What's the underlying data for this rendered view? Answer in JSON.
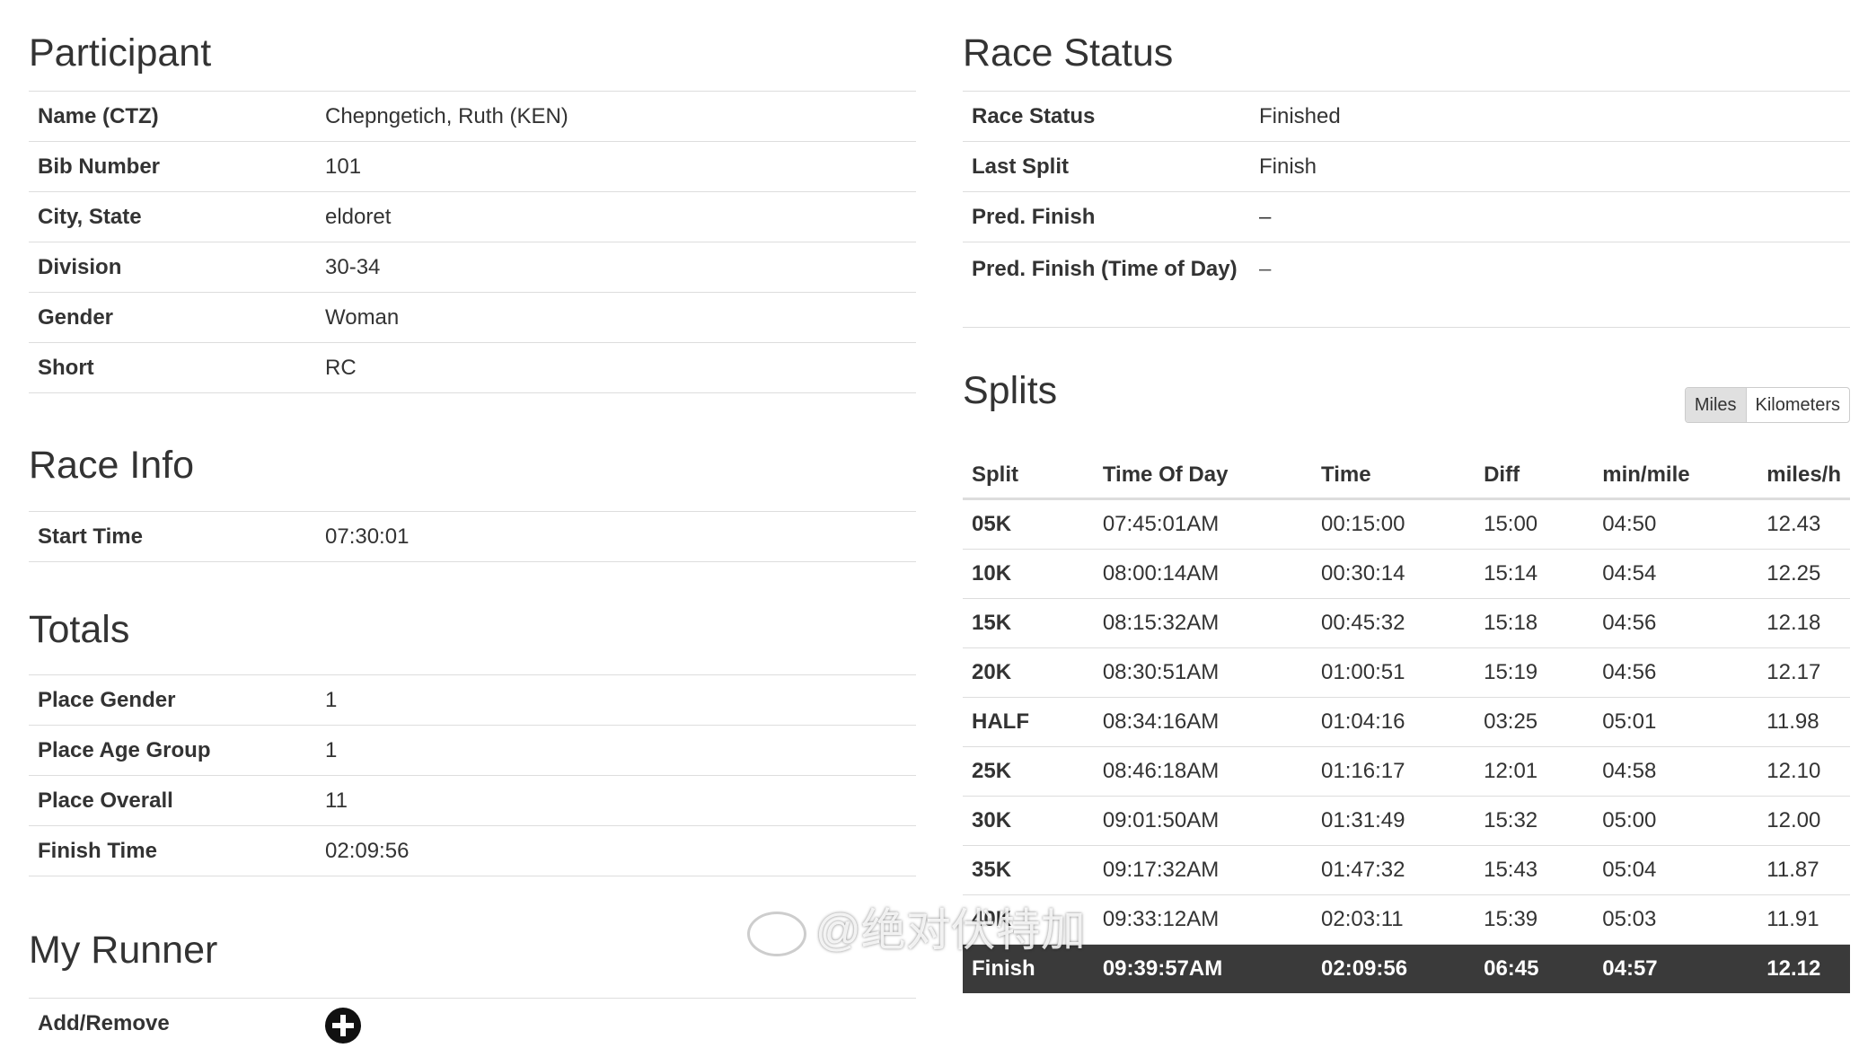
{
  "participant": {
    "title": "Participant",
    "rows": [
      {
        "label": "Name (CTZ)",
        "value": "Chepngetich, Ruth (KEN)"
      },
      {
        "label": "Bib Number",
        "value": "101"
      },
      {
        "label": "City, State",
        "value": "eldoret"
      },
      {
        "label": "Division",
        "value": "30-34"
      },
      {
        "label": "Gender",
        "value": "Woman"
      },
      {
        "label": "Short",
        "value": "RC"
      }
    ]
  },
  "race_info": {
    "title": "Race Info",
    "rows": [
      {
        "label": "Start Time",
        "value": "07:30:01"
      }
    ]
  },
  "totals": {
    "title": "Totals",
    "rows": [
      {
        "label": "Place Gender",
        "value": "1"
      },
      {
        "label": "Place Age Group",
        "value": "1"
      },
      {
        "label": "Place Overall",
        "value": "11"
      },
      {
        "label": "Finish Time",
        "value": "02:09:56"
      }
    ]
  },
  "my_runner": {
    "title": "My Runner",
    "label": "Add/Remove",
    "icon": "plus-circle-icon"
  },
  "race_status": {
    "title": "Race Status",
    "rows": [
      {
        "label": "Race Status",
        "value": "Finished"
      },
      {
        "label": "Last Split",
        "value": "Finish"
      },
      {
        "label": "Pred. Finish",
        "value": "–"
      },
      {
        "label": "Pred. Finish (Time of Day)",
        "value": "–"
      }
    ]
  },
  "splits": {
    "title": "Splits",
    "units": [
      "Miles",
      "Kilometers"
    ],
    "active_unit": "Miles",
    "columns": [
      "Split",
      "Time Of Day",
      "Time",
      "Diff",
      "min/mile",
      "miles/h"
    ],
    "rows": [
      [
        "05K",
        "07:45:01AM",
        "00:15:00",
        "15:00",
        "04:50",
        "12.43"
      ],
      [
        "10K",
        "08:00:14AM",
        "00:30:14",
        "15:14",
        "04:54",
        "12.25"
      ],
      [
        "15K",
        "08:15:32AM",
        "00:45:32",
        "15:18",
        "04:56",
        "12.18"
      ],
      [
        "20K",
        "08:30:51AM",
        "01:00:51",
        "15:19",
        "04:56",
        "12.17"
      ],
      [
        "HALF",
        "08:34:16AM",
        "01:04:16",
        "03:25",
        "05:01",
        "11.98"
      ],
      [
        "25K",
        "08:46:18AM",
        "01:16:17",
        "12:01",
        "04:58",
        "12.10"
      ],
      [
        "30K",
        "09:01:50AM",
        "01:31:49",
        "15:32",
        "05:00",
        "12.00"
      ],
      [
        "35K",
        "09:17:32AM",
        "01:47:32",
        "15:43",
        "05:04",
        "11.87"
      ],
      [
        "40K",
        "09:33:12AM",
        "02:03:11",
        "15:39",
        "05:03",
        "11.91"
      ],
      [
        "Finish",
        "09:39:57AM",
        "02:09:56",
        "06:45",
        "04:57",
        "12.12"
      ]
    ]
  },
  "watermark": {
    "text": "@绝对伏特加",
    "icon": "weibo-logo-icon"
  }
}
